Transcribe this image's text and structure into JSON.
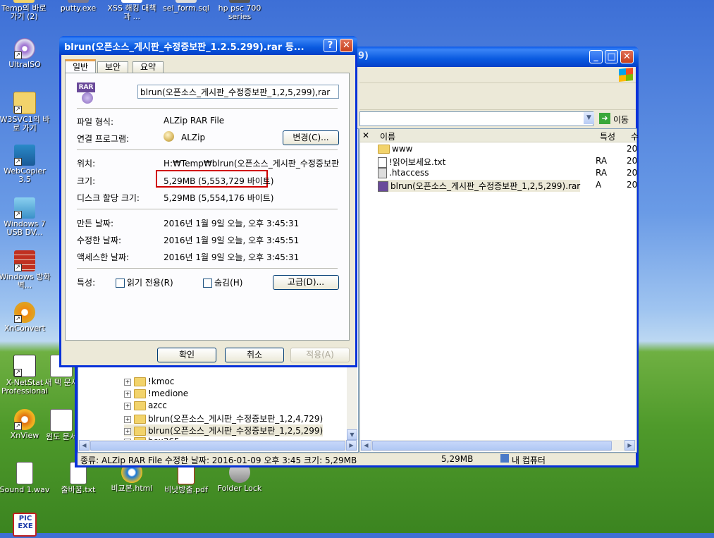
{
  "desktop_icons": [
    {
      "label": "Temp의 바로 가기 (2)",
      "icon": "folder-shortcut-icon"
    },
    {
      "label": "putty.exe",
      "icon": "putty-icon"
    },
    {
      "label": "XSS 해킹 대책과 ...",
      "icon": "document-icon"
    },
    {
      "label": "sel_form.sql",
      "icon": "sql-file-icon"
    },
    {
      "label": "hp psc 700 series",
      "icon": "printer-icon"
    },
    {
      "label": "UltraISO",
      "icon": "disc-icon"
    },
    {
      "label": "W3SVC1의 바로 가기",
      "icon": "folder-shortcut-icon"
    },
    {
      "label": "WebCopier 3.5",
      "icon": "webcopier-icon"
    },
    {
      "label": "Windows 7 USB DV...",
      "icon": "usb-tool-icon"
    },
    {
      "label": "Windows 방화벽...",
      "icon": "firewall-icon"
    },
    {
      "label": "XnConvert",
      "icon": "xnconvert-icon"
    },
    {
      "label": "X-NetStat Professional",
      "icon": "network-icon"
    },
    {
      "label": "새 텍 문서",
      "icon": "text-doc-icon"
    },
    {
      "label": "XnView",
      "icon": "xnview-icon"
    },
    {
      "label": "윈도 문서",
      "icon": "text-doc-icon"
    },
    {
      "label": "Sound 1.wav",
      "icon": "wav-file-icon"
    },
    {
      "label": "줄바꿈.txt",
      "icon": "text-doc-icon"
    },
    {
      "label": "비교본.html",
      "icon": "ie-html-icon"
    },
    {
      "label": "비낫방출.pdf",
      "icon": "pdf-icon"
    },
    {
      "label": "Folder Lock",
      "icon": "folder-lock-icon"
    },
    {
      "label": "PIC EXE",
      "icon": "pic-exe-icon"
    }
  ],
  "explorer": {
    "title_fragment": "9)",
    "go_label": "이동",
    "columns": {
      "name": "이름",
      "attr": "특성",
      "extra": "수"
    },
    "files": [
      {
        "name": "www",
        "attr": "",
        "extra": "20",
        "icon": "folder-icon"
      },
      {
        "name": "!읽어보세요.txt",
        "attr": "RA",
        "extra": "20",
        "icon": "text-file-icon"
      },
      {
        "name": ".htaccess",
        "attr": "RA",
        "extra": "20",
        "icon": "config-file-icon"
      },
      {
        "name": "blrun(오픈소스_게시판_수정증보판_1,2,5,299).rar",
        "attr": "A",
        "extra": "20",
        "icon": "rar-file-icon"
      }
    ],
    "tree": [
      {
        "name": "!kmoc",
        "expander": "+"
      },
      {
        "name": "!medione",
        "expander": "+"
      },
      {
        "name": "azcc",
        "expander": "+"
      },
      {
        "name": "blrun(오픈소스_게시판_수정증보판_1,2,4,729)",
        "expander": "+"
      },
      {
        "name": "blrun(오픈소스_게시판_수정증보판_1,2,5,299)",
        "expander": "+"
      },
      {
        "name": "box365",
        "expander": "+"
      }
    ],
    "status": {
      "details": "종류: ALZip RAR File 수정한 날짜: 2016-01-09 오후 3:45 크기: 5,29MB",
      "size": "5,29MB",
      "location": "내 컴퓨터"
    }
  },
  "dialog": {
    "title": "blrun(오픈소스_게시판_수정증보판_1.2.5.299).rar 등...",
    "help": "?",
    "close": "✕",
    "tabs": [
      "일반",
      "보안",
      "요약"
    ],
    "filename": "blrun(오픈소스_게시판_수정증보판_1,2,5,299),rar",
    "file_type_label": "파일 형식:",
    "file_type_value": "ALZip RAR File",
    "open_with_label": "연결 프로그램:",
    "open_with_value": "ALZip",
    "change_button": "변경(C)...",
    "location_label": "위치:",
    "location_value": "H:₩Temp₩blrun(오픈소스_게시판_수정증보판",
    "size_label": "크기:",
    "size_value": "5,29MB (5,553,729 바이트)",
    "disk_size_label": "디스크 할당 크기:",
    "disk_size_value": "5,29MB (5,554,176 바이트)",
    "created_label": "만든 날짜:",
    "created_value": "2016년 1월 9일 오늘, 오후 3:45:31",
    "modified_label": "수정한 날짜:",
    "modified_value": "2016년 1월 9일 오늘, 오후 3:45:51",
    "accessed_label": "액세스한 날짜:",
    "accessed_value": "2016년 1월 9일 오늘, 오후 3:45:31",
    "attributes_label": "특성:",
    "readonly_label": "읽기 전용(R)",
    "hidden_label": "숨김(H)",
    "advanced_button": "고급(D)...",
    "ok_button": "확인",
    "cancel_button": "취소",
    "apply_button": "적용(A)",
    "highlight_color": "#d00000"
  }
}
